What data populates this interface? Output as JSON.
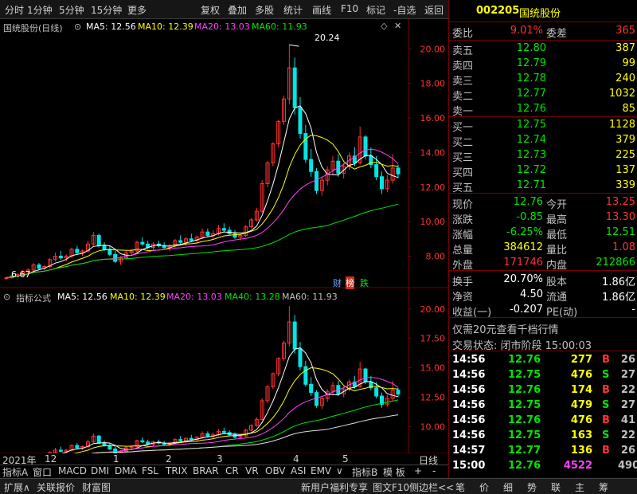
{
  "toolbar": {
    "items": [
      "分时",
      "1分钟",
      "5分钟",
      "15分钟",
      "更多",
      "复权",
      "叠加",
      "多股",
      "统计",
      "画线",
      "F10",
      "标记",
      "-自选",
      "返回"
    ]
  },
  "stock": {
    "code": "002205",
    "name": "国统股份"
  },
  "main_chart": {
    "title": "国统股份(日线)",
    "ma5": "MA5: 12.56",
    "ma10": "MA10: 12.39",
    "ma20": "MA20: 13.03",
    "ma60": "MA60: 11.93",
    "high_label": "20.24",
    "low_label": "6.67",
    "badges": [
      "财",
      "榜",
      "跌"
    ]
  },
  "sub_chart": {
    "title": "指标公式",
    "ma5": "MA5: 12.56",
    "ma10": "MA10: 12.39",
    "ma20": "MA20: 13.03",
    "ma40": "MA40: 13.28",
    "ma60": "MA60: 11.93"
  },
  "chart_data": [
    {
      "type": "line",
      "subtype": "candlestick",
      "title": "国统股份(日线)",
      "y_ticks": [
        "20.00",
        "18.00",
        "16.00",
        "14.00",
        "12.00",
        "10.00",
        "8.00"
      ],
      "ylim": [
        6.5,
        20.8
      ],
      "candles": [
        [
          6.7,
          6.8,
          6.6,
          6.75
        ],
        [
          6.75,
          6.9,
          6.7,
          6.85
        ],
        [
          6.85,
          7.0,
          6.8,
          6.95
        ],
        [
          6.9,
          7.2,
          6.85,
          7.1
        ],
        [
          7.1,
          7.3,
          7.0,
          7.2
        ],
        [
          7.2,
          7.6,
          7.1,
          7.5
        ],
        [
          7.5,
          7.6,
          7.2,
          7.3
        ],
        [
          7.3,
          7.5,
          7.2,
          7.4
        ],
        [
          7.4,
          7.9,
          7.3,
          7.8
        ],
        [
          7.8,
          8.2,
          7.7,
          8.0
        ],
        [
          8.0,
          8.3,
          7.8,
          7.9
        ],
        [
          7.9,
          8.1,
          7.7,
          8.0
        ],
        [
          8.0,
          8.5,
          7.9,
          8.4
        ],
        [
          8.4,
          8.6,
          8.1,
          8.2
        ],
        [
          8.2,
          8.4,
          8.0,
          8.3
        ],
        [
          8.3,
          8.9,
          8.2,
          8.7
        ],
        [
          8.7,
          9.4,
          8.6,
          9.2
        ],
        [
          9.2,
          9.3,
          8.5,
          8.6
        ],
        [
          8.6,
          8.8,
          8.3,
          8.4
        ],
        [
          8.4,
          8.6,
          8.0,
          8.1
        ],
        [
          8.1,
          8.3,
          7.6,
          7.7
        ],
        [
          7.7,
          8.0,
          7.5,
          7.9
        ],
        [
          7.9,
          8.3,
          7.8,
          8.2
        ],
        [
          8.2,
          8.4,
          8.0,
          8.3
        ],
        [
          8.3,
          8.9,
          8.2,
          8.8
        ],
        [
          8.8,
          9.1,
          8.6,
          8.7
        ],
        [
          8.7,
          8.9,
          8.4,
          8.5
        ],
        [
          8.5,
          8.8,
          8.3,
          8.7
        ],
        [
          8.7,
          8.9,
          8.5,
          8.6
        ],
        [
          8.6,
          8.8,
          8.4,
          8.5
        ],
        [
          8.5,
          8.7,
          8.3,
          8.6
        ],
        [
          8.6,
          9.0,
          8.5,
          8.9
        ],
        [
          8.9,
          9.2,
          8.7,
          8.8
        ],
        [
          8.8,
          9.1,
          8.6,
          9.0
        ],
        [
          9.0,
          9.3,
          8.8,
          8.9
        ],
        [
          8.9,
          9.2,
          8.7,
          9.1
        ],
        [
          9.1,
          9.6,
          9.0,
          9.4
        ],
        [
          9.4,
          9.6,
          9.1,
          9.2
        ],
        [
          9.2,
          9.5,
          9.0,
          9.3
        ],
        [
          9.3,
          9.8,
          9.2,
          9.6
        ],
        [
          9.6,
          9.9,
          9.4,
          9.5
        ],
        [
          9.5,
          9.7,
          9.2,
          9.3
        ],
        [
          9.3,
          9.5,
          9.0,
          9.1
        ],
        [
          9.1,
          9.3,
          8.9,
          9.2
        ],
        [
          9.2,
          9.8,
          9.1,
          9.7
        ],
        [
          9.7,
          10.2,
          9.6,
          10.1
        ],
        [
          10.1,
          10.8,
          10.0,
          10.6
        ],
        [
          10.6,
          12.4,
          10.5,
          12.2
        ],
        [
          12.2,
          13.5,
          12.0,
          13.4
        ],
        [
          13.4,
          14.6,
          13.2,
          14.5
        ],
        [
          14.5,
          15.9,
          14.3,
          15.8
        ],
        [
          15.8,
          17.3,
          15.6,
          17.1
        ],
        [
          17.1,
          20.24,
          16.8,
          18.9
        ],
        [
          18.9,
          19.5,
          16.2,
          16.6
        ],
        [
          16.6,
          17.2,
          14.8,
          15.1
        ],
        [
          15.1,
          15.6,
          13.4,
          13.6
        ],
        [
          13.6,
          14.2,
          12.6,
          12.9
        ],
        [
          12.9,
          13.1,
          11.6,
          11.8
        ],
        [
          11.8,
          12.6,
          11.5,
          12.4
        ],
        [
          12.4,
          13.2,
          12.1,
          13.0
        ],
        [
          13.0,
          13.8,
          12.7,
          13.5
        ],
        [
          13.5,
          13.9,
          12.6,
          12.8
        ],
        [
          12.8,
          13.4,
          12.5,
          13.2
        ],
        [
          13.2,
          14.0,
          13.0,
          13.8
        ],
        [
          13.8,
          14.3,
          13.2,
          13.4
        ],
        [
          13.4,
          15.5,
          13.3,
          14.9
        ],
        [
          14.9,
          15.0,
          13.6,
          13.8
        ],
        [
          13.8,
          14.3,
          13.1,
          13.3
        ],
        [
          13.3,
          13.8,
          12.4,
          12.6
        ],
        [
          12.6,
          12.9,
          11.6,
          11.9
        ],
        [
          11.9,
          12.7,
          11.7,
          12.4
        ],
        [
          12.4,
          13.9,
          12.2,
          13.1
        ],
        [
          13.1,
          13.3,
          12.5,
          12.76
        ]
      ]
    },
    {
      "type": "line",
      "title": "指标公式",
      "y_ticks": [
        "20.00",
        "17.50",
        "15.00",
        "12.50",
        "10.00"
      ],
      "ylim": [
        8.2,
        20.8
      ]
    }
  ],
  "bottom": {
    "year_label": "2021年",
    "month_labels": [
      "12",
      "1",
      "2",
      "3",
      "4",
      "5"
    ],
    "tabs": [
      "指标A",
      "窗口",
      "MACD",
      "DMI",
      "DMA",
      "FSL",
      "TRIX",
      "BRAR",
      "CR",
      "VR",
      "OBV",
      "ASI",
      "EMV"
    ],
    "arrow": "∨",
    "tab_b": "指标B",
    "template": "模 板",
    "plus": "+",
    "minus": "-",
    "period": "日线"
  },
  "quote": {
    "weibi": {
      "label": "委比",
      "value": "9.01%",
      "label2": "委差",
      "value2": "365"
    },
    "sell": [
      {
        "label": "卖五",
        "price": "12.80",
        "vol": "387"
      },
      {
        "label": "卖四",
        "price": "12.79",
        "vol": "99"
      },
      {
        "label": "卖三",
        "price": "12.78",
        "vol": "240"
      },
      {
        "label": "卖二",
        "price": "12.77",
        "vol": "1032"
      },
      {
        "label": "卖一",
        "price": "12.76",
        "vol": "85"
      }
    ],
    "buy": [
      {
        "label": "买一",
        "price": "12.75",
        "vol": "1128"
      },
      {
        "label": "买二",
        "price": "12.74",
        "vol": "379"
      },
      {
        "label": "买三",
        "price": "12.73",
        "vol": "225"
      },
      {
        "label": "买四",
        "price": "12.72",
        "vol": "137"
      },
      {
        "label": "买五",
        "price": "12.71",
        "vol": "339"
      }
    ],
    "stats": [
      {
        "l1": "现价",
        "v1": "12.76",
        "l2": "今开",
        "v2": "13.25"
      },
      {
        "l1": "涨跌",
        "v1": "-0.85",
        "l2": "最高",
        "v2": "13.30"
      },
      {
        "l1": "涨幅",
        "v1": "-6.25%",
        "l2": "最低",
        "v2": "12.51"
      },
      {
        "l1": "总量",
        "v1": "384612",
        "l2": "量比",
        "v2": "1.08"
      },
      {
        "l1": "外盘",
        "v1": "171746",
        "l2": "内盘",
        "v2": "212866"
      }
    ],
    "fin": [
      {
        "l1": "换手",
        "v1": "20.70%",
        "l2": "股本",
        "v2": "1.86亿"
      },
      {
        "l1": "净资",
        "v1": "4.50",
        "l2": "流通",
        "v2": "1.86亿"
      },
      {
        "l1": "收益(一)",
        "v1": "-0.207",
        "l2": "PE(动)",
        "v2": "-"
      }
    ],
    "promo": "仅需20元查看千档行情",
    "trade_status": "交易状态: 闭市阶段 15:00:03",
    "ticks": [
      {
        "time": "14:56",
        "price": "12.76",
        "vol": "277",
        "side": "B",
        "n": "26"
      },
      {
        "time": "14:56",
        "price": "12.75",
        "vol": "476",
        "side": "S",
        "n": "27"
      },
      {
        "time": "14:56",
        "price": "12.76",
        "vol": "174",
        "side": "B",
        "n": "22"
      },
      {
        "time": "14:56",
        "price": "12.75",
        "vol": "479",
        "side": "S",
        "n": "27"
      },
      {
        "time": "14:56",
        "price": "12.76",
        "vol": "476",
        "side": "B",
        "n": "41"
      },
      {
        "time": "14:56",
        "price": "12.75",
        "vol": "163",
        "side": "S",
        "n": "22"
      },
      {
        "time": "14:57",
        "price": "12.77",
        "vol": "136",
        "side": "B",
        "n": "26"
      },
      {
        "time": "15:00",
        "price": "12.76",
        "vol": "4522",
        "side": "",
        "n": "490"
      }
    ]
  },
  "footer": {
    "items": [
      "扩展∧",
      "关联报价",
      "财富图"
    ],
    "promo": "新用户福利专享",
    "f10": "图文F10",
    "sidebar": "侧边栏<<",
    "tabs": [
      "笔",
      "价",
      "细",
      "势",
      "联",
      "主",
      "筹"
    ]
  },
  "colors": {
    "up": "#ff3232",
    "down": "#00e6e6",
    "ma5": "#ffffff",
    "ma10": "#ffff00",
    "ma20": "#ff40ff",
    "ma60": "#00e600",
    "grid": "#7a0000"
  }
}
